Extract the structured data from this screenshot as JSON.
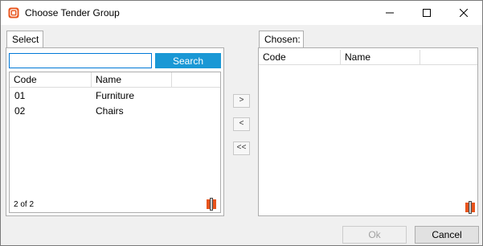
{
  "window": {
    "title": "Choose Tender Group",
    "icon": "tender-group-app-icon",
    "controls": [
      "minimize-icon",
      "maximize-icon",
      "close-icon"
    ]
  },
  "select_panel": {
    "tab_label": "Select",
    "search": {
      "value": "",
      "placeholder": "",
      "button_label": "Search"
    },
    "columns": [
      "Code",
      "Name"
    ],
    "rows": [
      {
        "code": "01",
        "name": "Furniture"
      },
      {
        "code": "02",
        "name": "Chairs"
      }
    ],
    "count_text": "2 of 2"
  },
  "move_buttons": {
    "add": ">",
    "remove": "<",
    "remove_all": "<<"
  },
  "chosen_panel": {
    "tab_label": "Chosen:",
    "columns": [
      "Code",
      "Name"
    ],
    "rows": []
  },
  "buttons": {
    "ok": "Ok",
    "cancel": "Cancel"
  },
  "colors": {
    "accent": "#1a98d5",
    "focus_border": "#0078d7",
    "icon_orange": "#e8541c"
  }
}
